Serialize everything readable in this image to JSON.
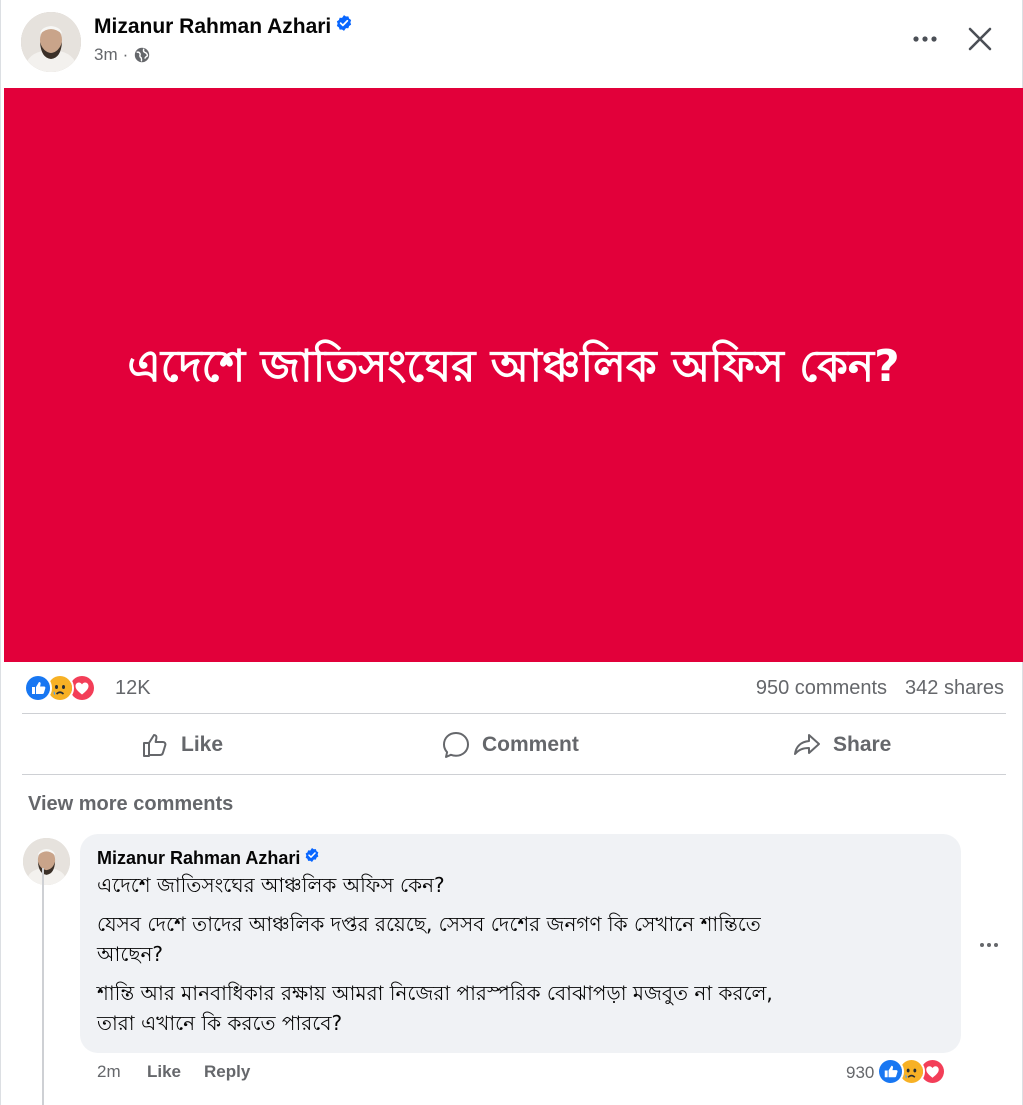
{
  "post": {
    "author": "Mizanur Rahman Azhari",
    "time": "3m",
    "meta_separator": "·",
    "image_text": "এদেশে জাতিসংঘের আঞ্চলিক অফিস কেন?",
    "image_bg_color": "#e2003a",
    "reaction_icons": [
      "like-icon",
      "sad-icon",
      "love-icon"
    ],
    "reaction_count": "12K",
    "comments_count": "950 comments",
    "shares_count": "342 shares"
  },
  "actions": {
    "like_label": "Like",
    "comment_label": "Comment",
    "share_label": "Share"
  },
  "comments": {
    "view_more_label": "View more comments",
    "items": [
      {
        "author": "Mizanur Rahman Azhari",
        "lines": [
          "এদেশে জাতিসংঘের আঞ্চলিক অফিস কেন?",
          "যেসব দেশে তাদের আঞ্চলিক দপ্তর রয়েছে, সেসব দেশের জনগণ কি সেখানে শান্তিতে",
          "আছেন?",
          "শান্তি আর মানবাধিকার রক্ষায় আমরা নিজেরা পারস্পরিক বোঝাপড়া মজবুত না করলে,",
          "তারা এখানে কি করতে পারবে?"
        ],
        "time": "2m",
        "like_label": "Like",
        "reply_label": "Reply",
        "reaction_count": "930",
        "reaction_icons": [
          "like-icon",
          "sad-icon",
          "love-icon"
        ]
      }
    ]
  },
  "colors": {
    "verified": "#0866ff",
    "like": "#1877f2",
    "love": "#f33e58",
    "sad": "#f7b125"
  }
}
